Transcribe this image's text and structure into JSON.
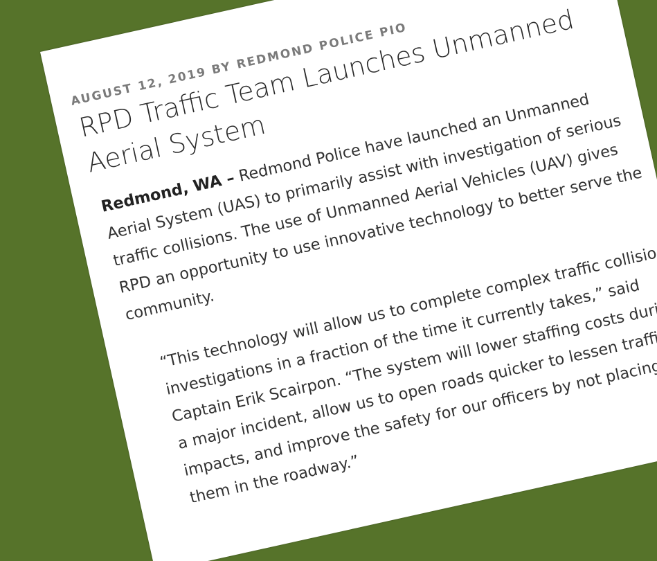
{
  "article": {
    "date": "AUGUST 12, 2019",
    "by": "BY",
    "author": "REDMOND POLICE PIO",
    "title": "RPD Traffic Team Launches Unmanned Aerial System",
    "lead_dateline": "Redmond, WA –",
    "lead_body": " Redmond Police have launched an Unmanned Aerial System (UAS) to primarily assist with investigation of serious traffic collisions. The use of Unmanned Aerial Vehicles (UAV) gives RPD an opportunity to use innovative technology to better serve the community.",
    "quote": "“This technology will allow us to complete complex traffic collision investigations in a fraction of the time it currently takes,” said Captain Erik Scairpon. “The system will lower staffing costs during a major incident, allow us to open roads quicker to lessen traffic impacts, and improve the safety for our officers by not placing them in the roadway.”"
  }
}
